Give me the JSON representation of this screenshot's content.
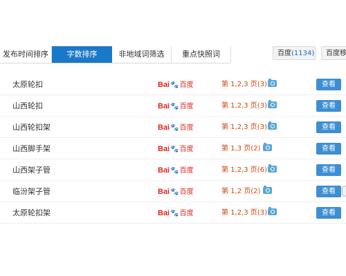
{
  "tabs": [
    {
      "label": "发布时间排序",
      "active": false
    },
    {
      "label": "字数排序",
      "active": true
    },
    {
      "label": "非地域词筛选",
      "active": false
    },
    {
      "label": "重点快照词",
      "active": false
    }
  ],
  "engines": [
    {
      "name": "百度",
      "count": "(1134)"
    },
    {
      "name": "百度移动",
      "count": ""
    }
  ],
  "colors": {
    "accent": "#1a78c8",
    "button": "#3c8fd2",
    "rank": "#d0460c"
  },
  "icons": {
    "snapshot": "camera-icon",
    "engine": "baidu-logo"
  },
  "logo": {
    "part1": "Bai",
    "paw": "🐾",
    "part2": "百度"
  },
  "view_label": "查看",
  "rows": [
    {
      "keyword": "太原轮扣",
      "rank": "第 1,2,3 页(3)"
    },
    {
      "keyword": "山西轮扣",
      "rank": "第 1,2,3 页(3)"
    },
    {
      "keyword": "山西轮扣架",
      "rank": "第 1,2,3 页(3)"
    },
    {
      "keyword": "山西脚手架",
      "rank": "第 1,3 页(2)"
    },
    {
      "keyword": "山西架子管",
      "rank": "第 1,2,3 页(6)"
    },
    {
      "keyword": "临汾架子管",
      "rank": "第 1,2 页(2)"
    },
    {
      "keyword": "太原轮扣架",
      "rank": "第 1,2,3 页(3)"
    }
  ]
}
